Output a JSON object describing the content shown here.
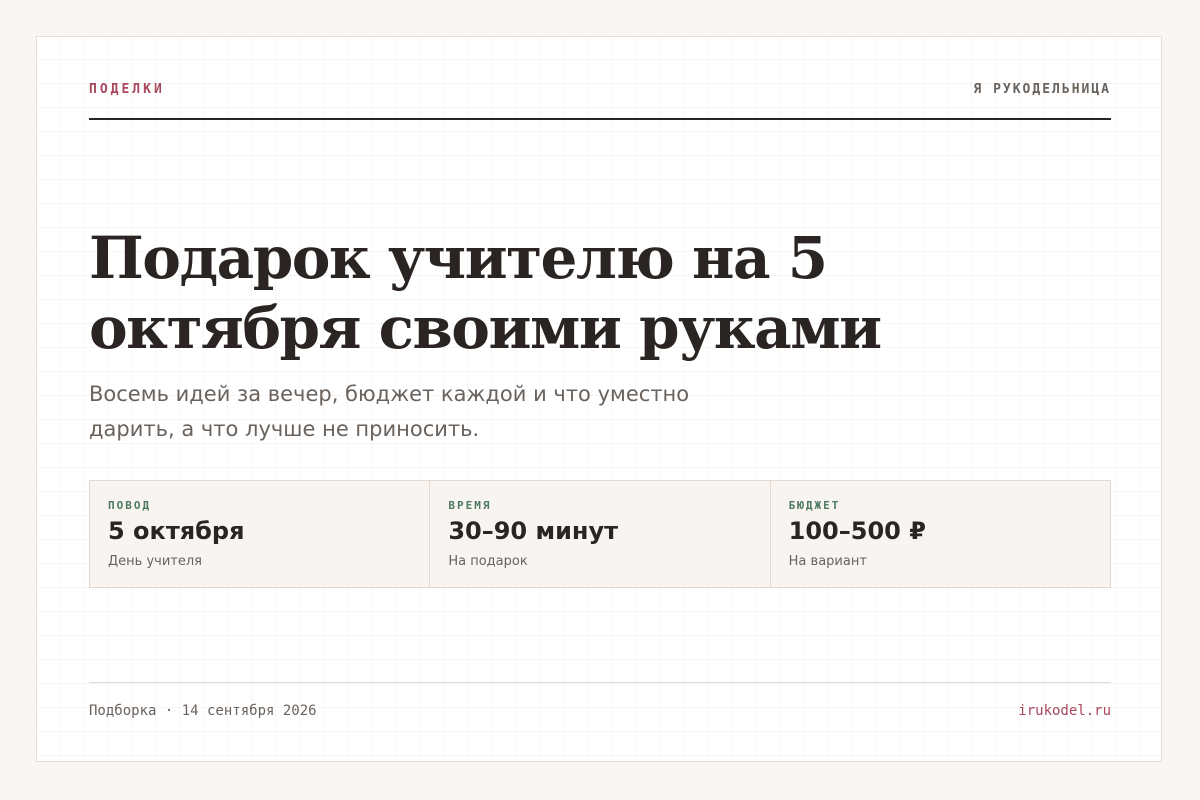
{
  "header": {
    "kicker": "ПОДЕЛКИ",
    "brand": "Я РУКОДЕЛЬНИЦА"
  },
  "hero": {
    "title": "Подарок учителю на 5 октября своими руками",
    "subtitle": "Восемь идей за вечер, бюджет каждой и что уместно дарить, а что лучше не приносить."
  },
  "stats": [
    {
      "label": "ПОВОД",
      "value": "5 октября",
      "note": "День учителя"
    },
    {
      "label": "ВРЕМЯ",
      "value": "30–90 минут",
      "note": "На подарок"
    },
    {
      "label": "БЮДЖЕТ",
      "value": "100–500 ₽",
      "note": "На вариант"
    }
  ],
  "footer": {
    "meta": "Подборка · 14 сентября 2026",
    "site": "irukodel.ru"
  },
  "colors": {
    "accent": "#a8485d",
    "label_green": "#4f7a5f",
    "ink": "#2a2522",
    "muted": "#6a625c"
  }
}
